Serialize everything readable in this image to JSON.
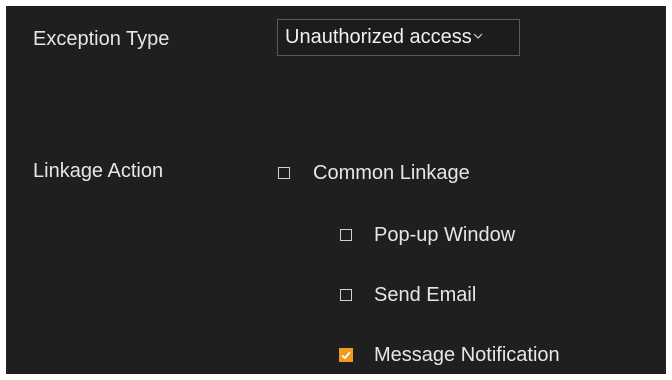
{
  "exception": {
    "label": "Exception Type",
    "selected": "Unauthorized access",
    "dropdown_icon": "chevron-down-icon"
  },
  "linkage": {
    "label": "Linkage Action",
    "common": {
      "label": "Common Linkage",
      "checked": false
    },
    "options": [
      {
        "label": "Pop-up Window",
        "checked": false
      },
      {
        "label": "Send Email",
        "checked": false
      },
      {
        "label": "Message Notification",
        "checked": true
      }
    ]
  },
  "colors": {
    "panel_background": "#1f1f1f",
    "text": "#e6e6e6",
    "accent_checked": "#f39a1e"
  }
}
